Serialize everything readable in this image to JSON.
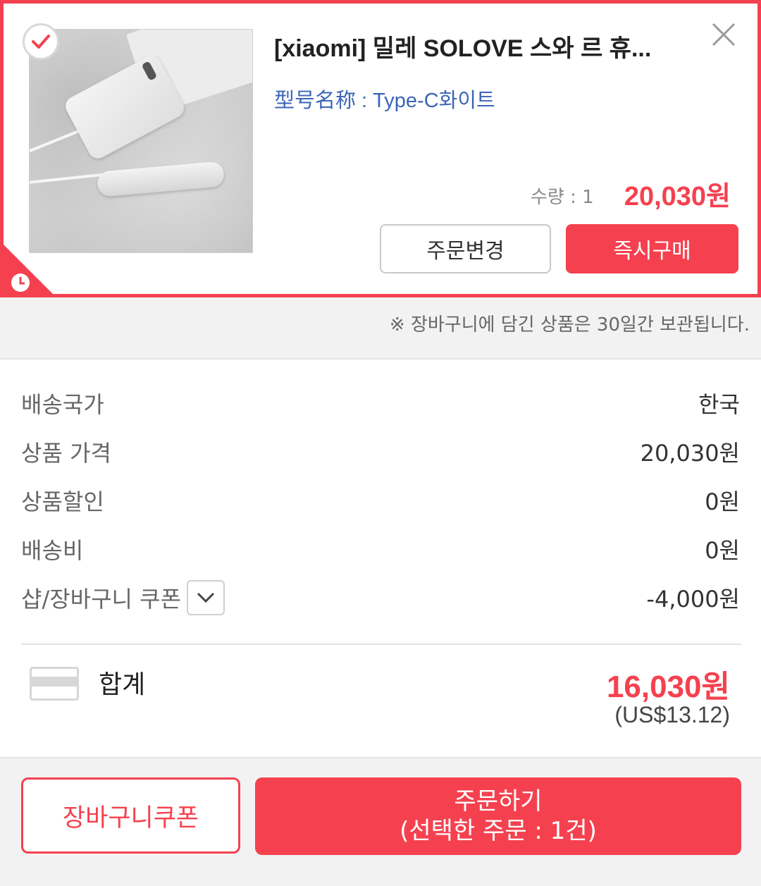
{
  "product": {
    "title": "[xiaomi] 밀레 SOLOVE 스와 르 휴...",
    "option": "型号名称 : Type-C화이트",
    "quantity": "수량 : 1",
    "price": "20,030원",
    "change_button": "주문변경",
    "buy_now_button": "즉시구매",
    "selected": true
  },
  "notice": "※ 장바구니에 담긴 상품은 30일간 보관됩니다.",
  "summary": {
    "rows": [
      {
        "label": "배송국가",
        "value": "한국"
      },
      {
        "label": "상품 가격",
        "value": "20,030원"
      },
      {
        "label": "상품할인",
        "value": "0원"
      },
      {
        "label": "배송비",
        "value": "0원"
      },
      {
        "label": "샵/장바구니 쿠폰",
        "value": "-4,000원"
      }
    ],
    "total_label": "합계",
    "total_value": "16,030원",
    "total_usd": "(US$13.12)"
  },
  "footer": {
    "coupon_button": "장바구니쿠폰",
    "order_button_line1": "주문하기",
    "order_button_line2": "(선택한 주문 : 1건)"
  },
  "colors": {
    "accent": "#f5414f",
    "option_text": "#3a64b7"
  },
  "icons": [
    "check-icon",
    "close-icon",
    "clock-icon",
    "chevron-down-icon",
    "card-icon"
  ]
}
